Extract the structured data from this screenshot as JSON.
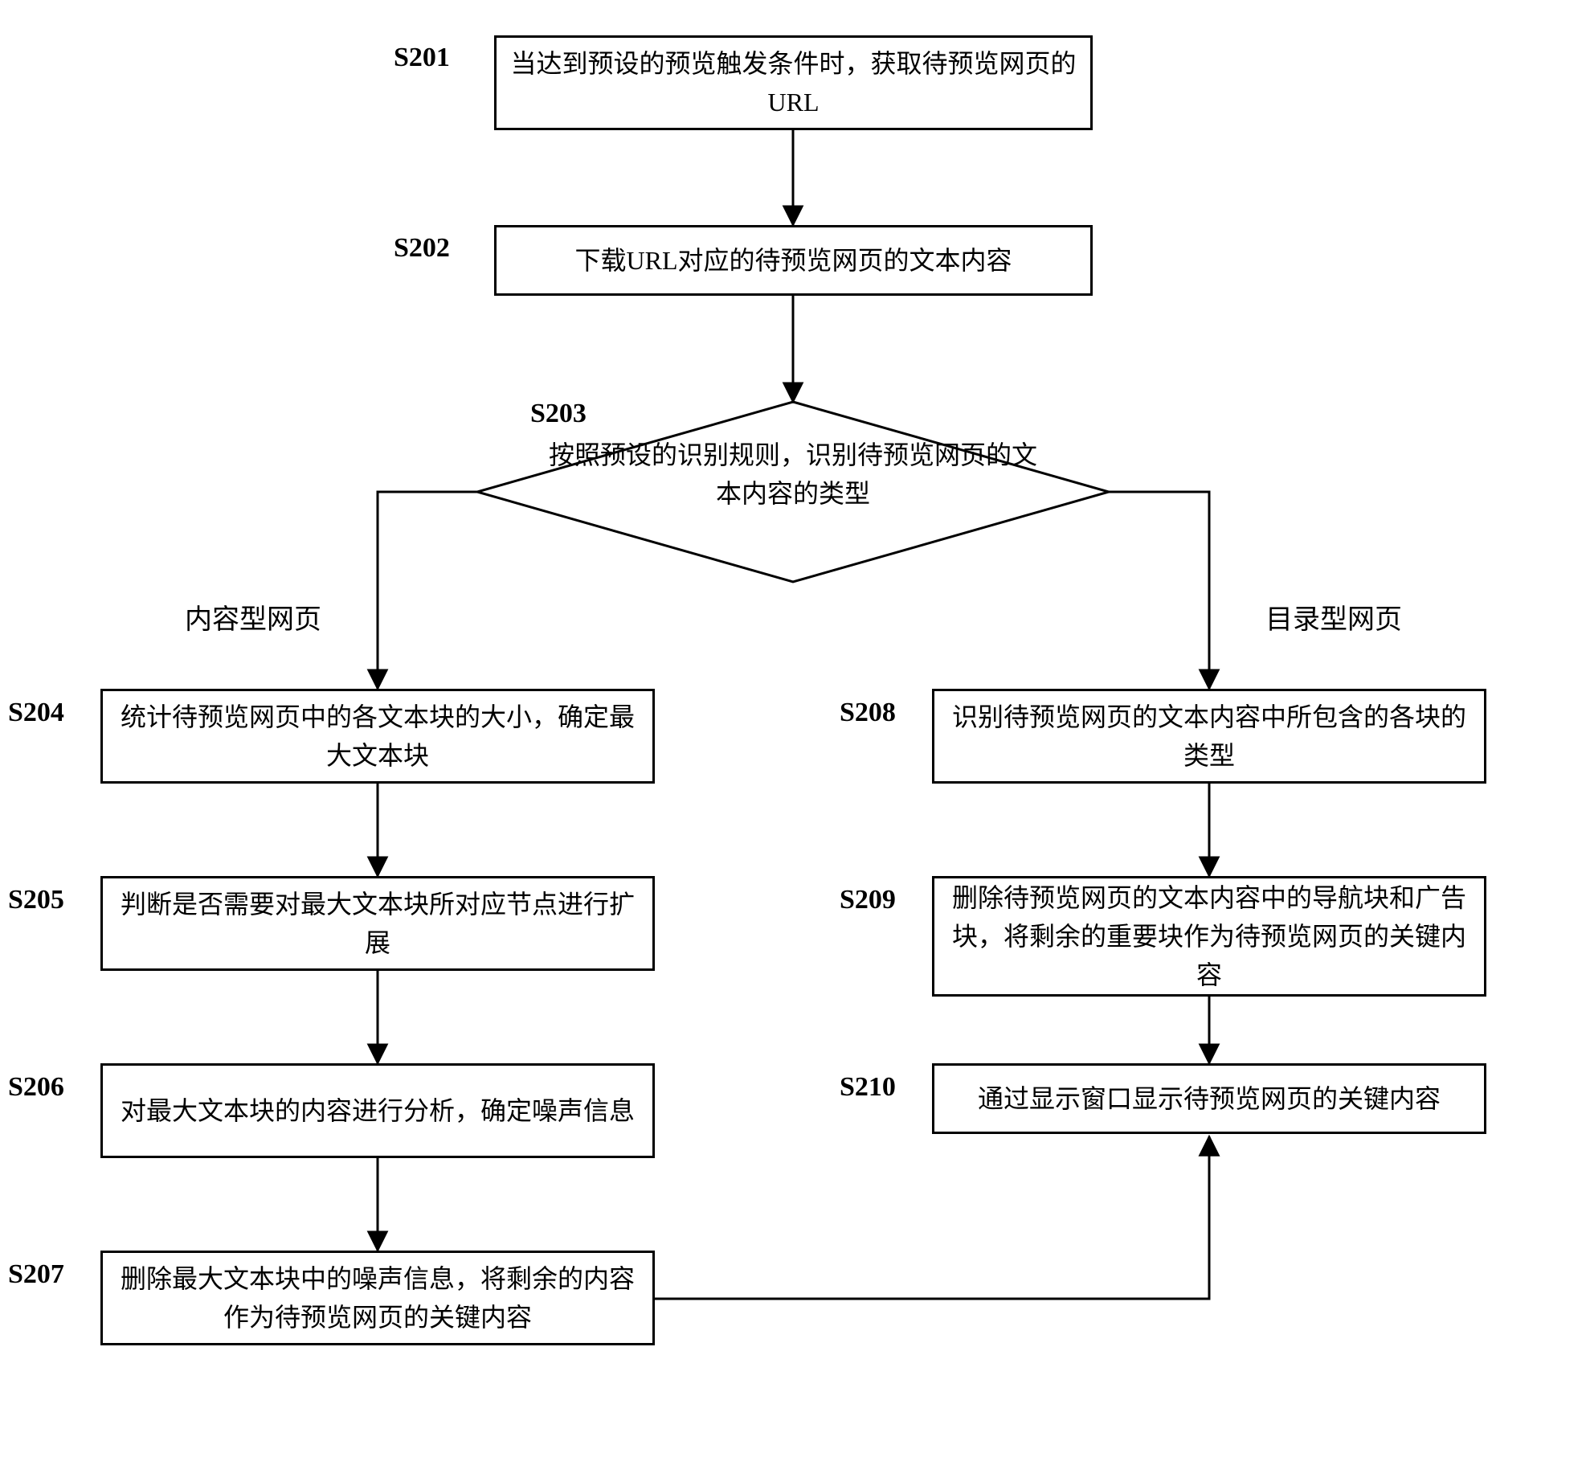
{
  "steps": {
    "s201": {
      "label": "S201",
      "text": "当达到预设的预览触发条件时，获取待预览网页的URL"
    },
    "s202": {
      "label": "S202",
      "text": "下载URL对应的待预览网页的文本内容"
    },
    "s203": {
      "label": "S203",
      "text": "按照预设的识别规则，识别待预览网页的文本内容的类型"
    },
    "s204": {
      "label": "S204",
      "text": "统计待预览网页中的各文本块的大小，确定最大文本块"
    },
    "s205": {
      "label": "S205",
      "text": "判断是否需要对最大文本块所对应节点进行扩展"
    },
    "s206": {
      "label": "S206",
      "text": "对最大文本块的内容进行分析，确定噪声信息"
    },
    "s207": {
      "label": "S207",
      "text": "删除最大文本块中的噪声信息，将剩余的内容作为待预览网页的关键内容"
    },
    "s208": {
      "label": "S208",
      "text": "识别待预览网页的文本内容中所包含的各块的类型"
    },
    "s209": {
      "label": "S209",
      "text": "删除待预览网页的文本内容中的导航块和广告块，将剩余的重要块作为待预览网页的关键内容"
    },
    "s210": {
      "label": "S210",
      "text": "通过显示窗口显示待预览网页的关键内容"
    }
  },
  "branches": {
    "left": "内容型网页",
    "right": "目录型网页"
  }
}
